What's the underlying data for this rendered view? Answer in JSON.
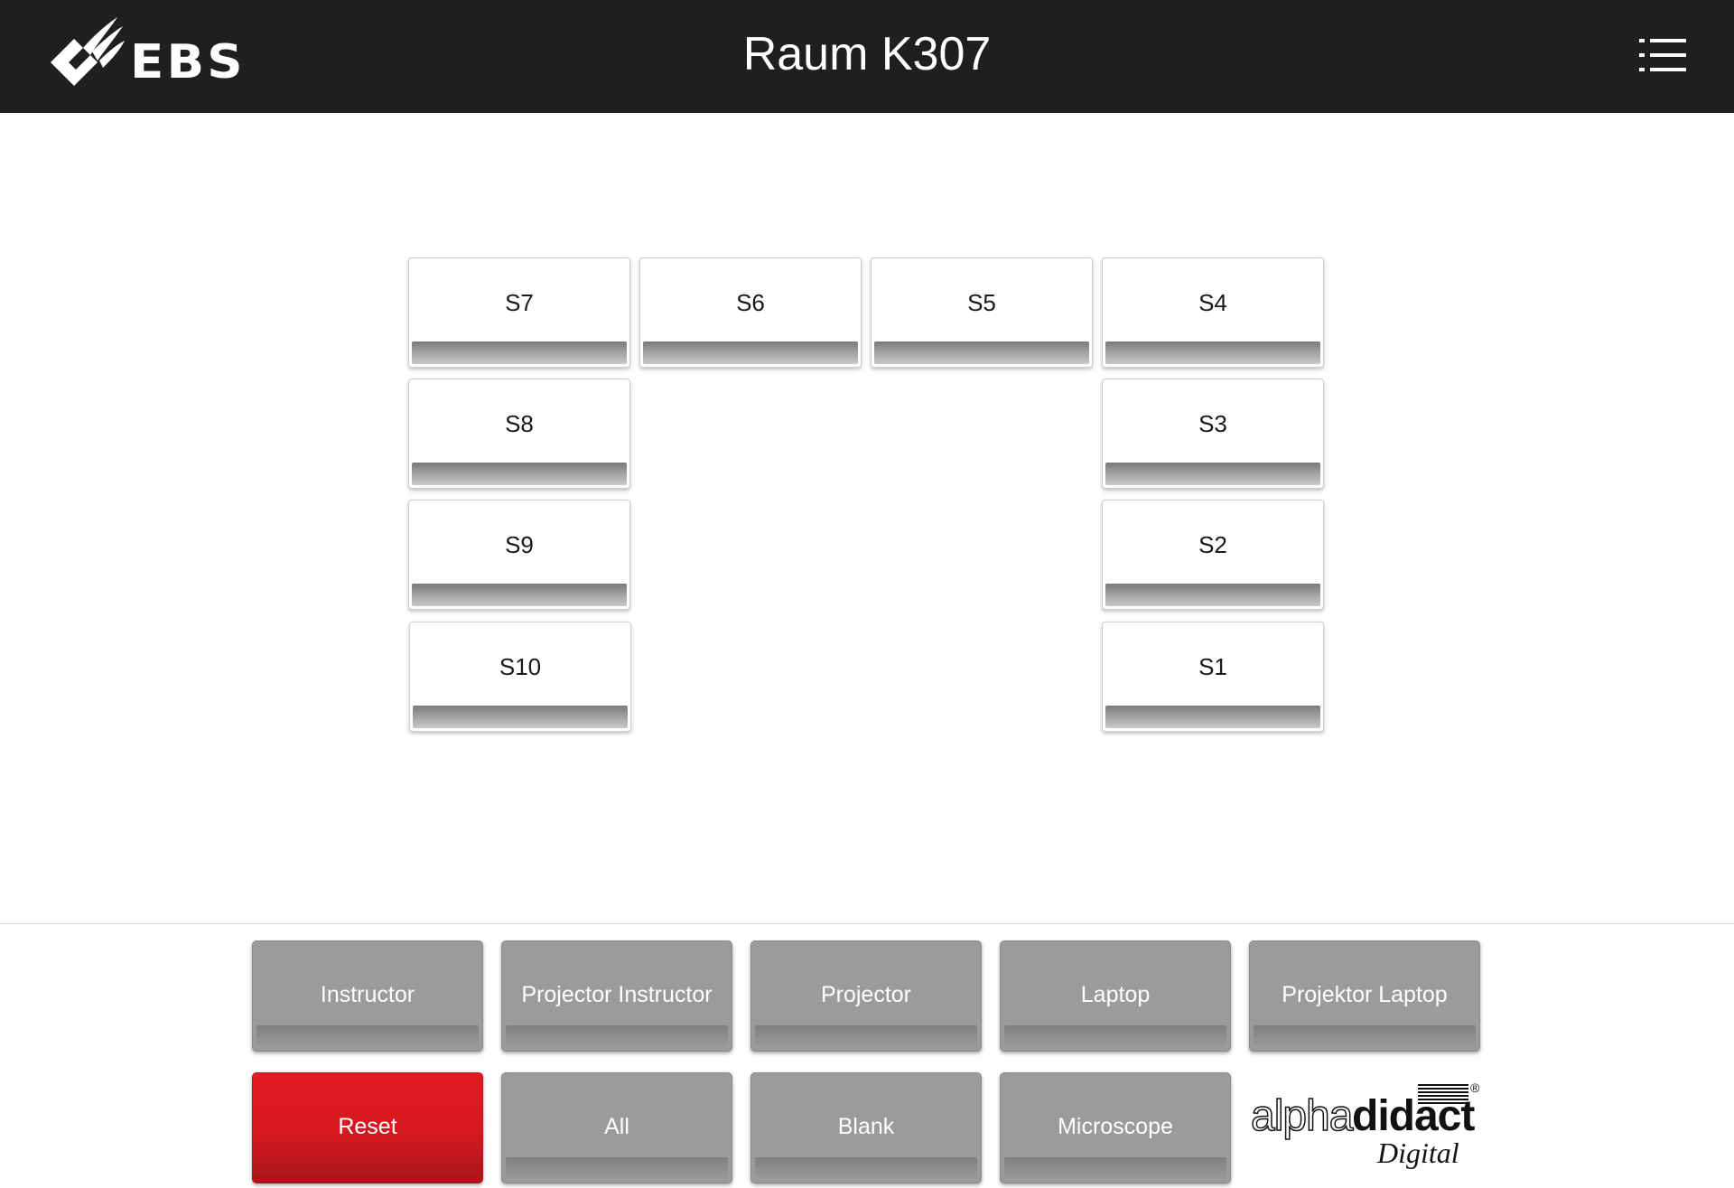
{
  "header": {
    "logo_text": "EBS",
    "title": "Raum K307",
    "menu_icon": "list-menu-icon"
  },
  "seats": {
    "s7": "S7",
    "s6": "S6",
    "s5": "S5",
    "s4": "S4",
    "s8": "S8",
    "s3": "S3",
    "s9": "S9",
    "s2": "S2",
    "s10": "S10",
    "s1": "S1"
  },
  "controls": {
    "instructor": "Instructor",
    "projector_instructor": "Projector Instructor",
    "projector": "Projector",
    "laptop": "Laptop",
    "projektor_laptop": "Projektor Laptop",
    "reset": "Reset",
    "all": "All",
    "blank": "Blank",
    "microscope": "Microscope"
  },
  "brand": {
    "alpha": "alpha",
    "didact": "didact",
    "digital": "Digital",
    "registered": "®"
  },
  "colors": {
    "header_bg": "#1f1f1f",
    "button_gray": "#9b9b9b",
    "reset_red": "#e31b23"
  }
}
